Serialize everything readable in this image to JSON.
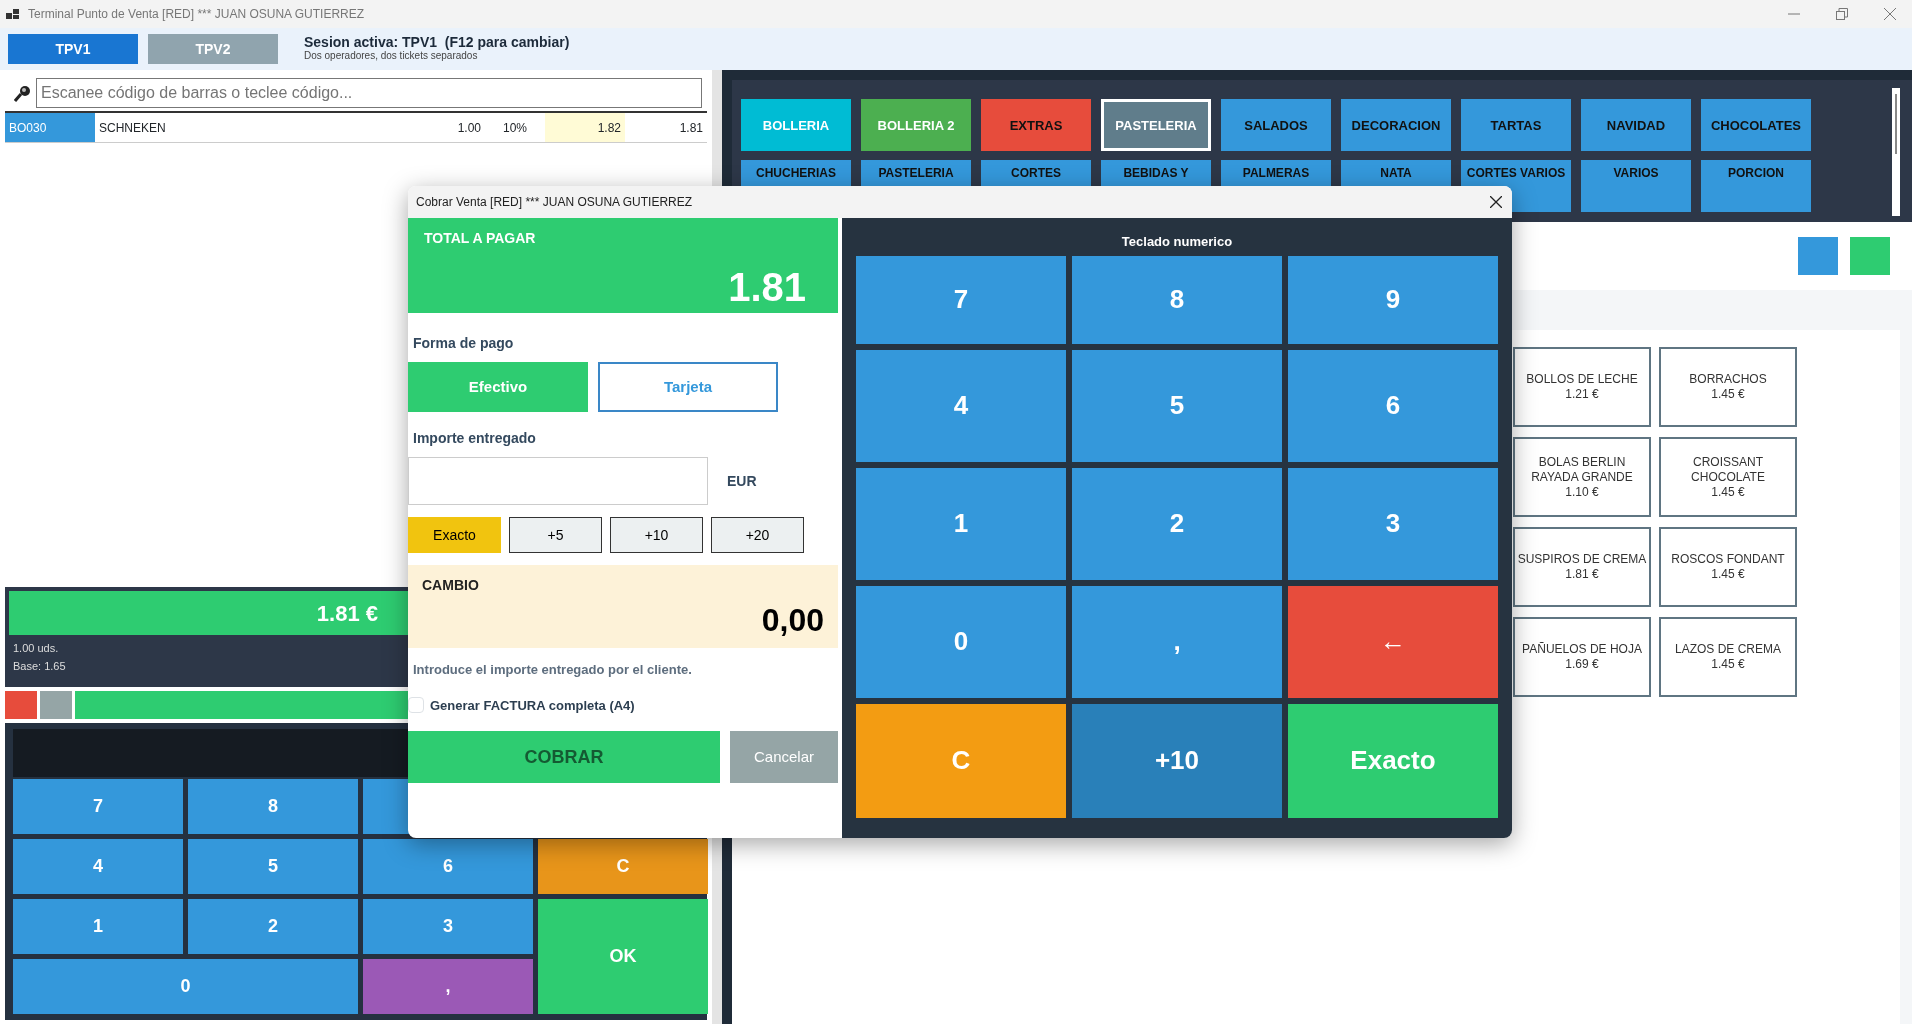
{
  "window": {
    "title": "Terminal Punto de Venta [RED] *** JUAN OSUNA GUTIERREZ"
  },
  "session_tabs": [
    {
      "label": "TPV1",
      "selected": true
    },
    {
      "label": "TPV2",
      "selected": false
    }
  ],
  "session_info": {
    "title": "Sesion activa: TPV1  (F12 para cambiar)",
    "subtitle": "Dos operadores, dos tickets separados"
  },
  "search": {
    "placeholder": "Escanee código de barras o teclee código..."
  },
  "ticket_lines": [
    {
      "code": "BO030",
      "name": "SCHNEKEN",
      "quantity": "1.00",
      "tax": "10%",
      "price": "1.82",
      "total": "1.81"
    }
  ],
  "ticket_total": {
    "total": "1.81 €",
    "units": "1.00 uds.",
    "base": "Base: 1.65"
  },
  "action_buttons": [
    {
      "color": "#e74c3c"
    },
    {
      "color": "#95a5a6"
    },
    {
      "color": "#2ecc71"
    }
  ],
  "keypad": [
    {
      "label": "7",
      "kind": "digit"
    },
    {
      "label": "8",
      "kind": "digit"
    },
    {
      "label": "4",
      "kind": "digit"
    },
    {
      "label": "5",
      "kind": "digit"
    },
    {
      "label": "6",
      "kind": "digit"
    },
    {
      "label": "C",
      "kind": "clear"
    },
    {
      "label": "1",
      "kind": "digit"
    },
    {
      "label": "2",
      "kind": "digit"
    },
    {
      "label": "3",
      "kind": "digit"
    },
    {
      "label": "OK",
      "kind": "ok"
    },
    {
      "label": "0",
      "kind": "zero"
    },
    {
      "label": ",",
      "kind": "decimal"
    }
  ],
  "categories": [
    {
      "label": "BOLLERIA",
      "color": "#00bcd4",
      "selected": false
    },
    {
      "label": "BOLLERIA 2",
      "color": "#4caf50",
      "selected": false
    },
    {
      "label": "EXTRAS",
      "color": "#e74c3c",
      "selected": false
    },
    {
      "label": "PASTELERIA",
      "color": "#607d8b",
      "selected": true
    },
    {
      "label": "SALADOS",
      "color": "#3498db",
      "selected": false
    },
    {
      "label": "DECORACION",
      "color": "#3498db",
      "selected": false
    },
    {
      "label": "TARTAS",
      "color": "#3498db",
      "selected": false
    },
    {
      "label": "NAVIDAD",
      "color": "#3498db",
      "selected": false
    },
    {
      "label": "CHOCOLATES",
      "color": "#3498db",
      "selected": false
    },
    {
      "label": "CHUCHERIAS",
      "color": "#3498db",
      "selected": false
    },
    {
      "label": "PASTELERIA",
      "color": "#3498db",
      "selected": false
    },
    {
      "label": "CORTES",
      "color": "#3498db",
      "selected": false
    },
    {
      "label": "BEBIDAS Y",
      "color": "#3498db",
      "selected": false
    },
    {
      "label": "PALMERAS",
      "color": "#3498db",
      "selected": false
    },
    {
      "label": "NATA",
      "color": "#3498db",
      "selected": false
    },
    {
      "label": "CORTES VARIOS",
      "color": "#3498db",
      "selected": false
    },
    {
      "label": "VARIOS",
      "color": "#3498db",
      "selected": false
    },
    {
      "label": "PORCION",
      "color": "#3498db",
      "selected": false
    }
  ],
  "view_buttons": [
    {
      "color": "#3498db"
    },
    {
      "color": "#2ecc71"
    }
  ],
  "products": [
    {
      "name": "BOLLOS DE LECHE",
      "price": "1.21 €"
    },
    {
      "name": "BORRACHOS",
      "price": "1.45 €"
    },
    {
      "name": "BOLAS BERLIN RAYADA GRANDE",
      "price": "1.10 €"
    },
    {
      "name": "CROISSANT CHOCOLATE",
      "price": "1.45 €"
    },
    {
      "name": "SUSPIROS DE CREMA",
      "price": "1.81 €"
    },
    {
      "name": "ROSCOS FONDANT",
      "price": "1.45 €"
    },
    {
      "name": "PAÑUELOS DE HOJA",
      "price": "1.69 €"
    },
    {
      "name": "LAZOS DE CREMA",
      "price": "1.45 €"
    }
  ],
  "dialog": {
    "title": "Cobrar Venta [RED] *** JUAN OSUNA GUTIERREZ",
    "total_label": "TOTAL A PAGAR",
    "total": "1.81",
    "payment_label": "Forma de pago",
    "payment_methods": [
      {
        "label": "Efectivo",
        "selected": true
      },
      {
        "label": "Tarjeta",
        "selected": false
      }
    ],
    "amount_label": "Importe entregado",
    "currency": "EUR",
    "quick_amounts": [
      {
        "label": "Exacto",
        "kind": "exact"
      },
      {
        "label": "+5",
        "kind": "add"
      },
      {
        "label": "+10",
        "kind": "add"
      },
      {
        "label": "+20",
        "kind": "add"
      }
    ],
    "change_label": "CAMBIO",
    "change": "0,00",
    "hint": "Introduce el importe entregado por el cliente.",
    "invoice": {
      "label": "Generar FACTURA completa (A4)",
      "checked": false
    },
    "confirm": "COBRAR",
    "cancel": "Cancelar",
    "keypad_title": "Teclado numerico",
    "keys": [
      {
        "label": "7",
        "kind": "digit"
      },
      {
        "label": "8",
        "kind": "digit"
      },
      {
        "label": "9",
        "kind": "digit"
      },
      {
        "label": "4",
        "kind": "digit"
      },
      {
        "label": "5",
        "kind": "digit"
      },
      {
        "label": "6",
        "kind": "digit"
      },
      {
        "label": "1",
        "kind": "digit"
      },
      {
        "label": "2",
        "kind": "digit"
      },
      {
        "label": "3",
        "kind": "digit"
      },
      {
        "label": "0",
        "kind": "digit"
      },
      {
        "label": ",",
        "kind": "digit"
      },
      {
        "label": "←",
        "kind": "backspace"
      },
      {
        "label": "C",
        "kind": "clear"
      },
      {
        "label": "+10",
        "kind": "add"
      },
      {
        "label": "Exacto",
        "kind": "exact"
      }
    ]
  }
}
